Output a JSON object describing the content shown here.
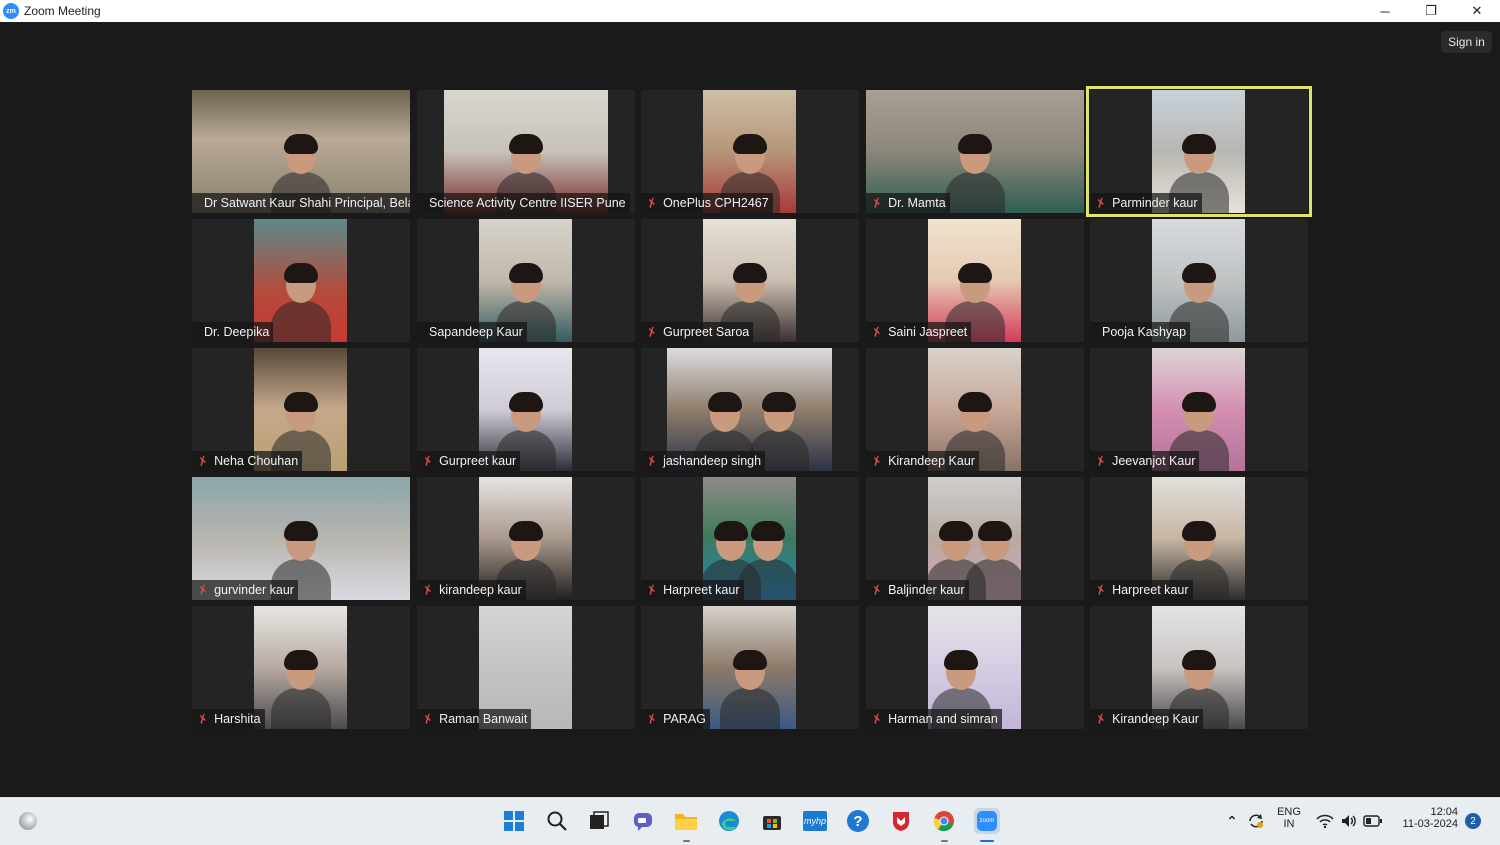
{
  "window": {
    "title": "Zoom Meeting",
    "minimize": "─",
    "restore": "❐",
    "close": "✕"
  },
  "signin": {
    "label": "Sign in"
  },
  "participants": [
    {
      "name": "Dr Satwant Kaur Shahi Principal, Bela ...",
      "muted": false,
      "active": false
    },
    {
      "name": "Science Activity Centre IISER Pune",
      "muted": false,
      "active": false
    },
    {
      "name": "OnePlus CPH2467",
      "muted": true,
      "active": false
    },
    {
      "name": "Dr. Mamta",
      "muted": true,
      "active": false
    },
    {
      "name": "Parminder kaur",
      "muted": true,
      "active": true
    },
    {
      "name": "Dr. Deepika",
      "muted": false,
      "active": false
    },
    {
      "name": "Sapandeep Kaur",
      "muted": false,
      "active": false
    },
    {
      "name": "Gurpreet Saroa",
      "muted": true,
      "active": false
    },
    {
      "name": "Saini Jaspreet",
      "muted": true,
      "active": false
    },
    {
      "name": "Pooja Kashyap",
      "muted": false,
      "active": false
    },
    {
      "name": "Neha Chouhan",
      "muted": true,
      "active": false
    },
    {
      "name": "Gurpreet kaur",
      "muted": true,
      "active": false
    },
    {
      "name": "jashandeep singh",
      "muted": true,
      "active": false
    },
    {
      "name": "Kirandeep Kaur",
      "muted": true,
      "active": false
    },
    {
      "name": "Jeevanjot Kaur",
      "muted": true,
      "active": false
    },
    {
      "name": "gurvinder kaur",
      "muted": true,
      "active": false
    },
    {
      "name": "kirandeep kaur",
      "muted": true,
      "active": false
    },
    {
      "name": "Harpreet kaur",
      "muted": true,
      "active": false
    },
    {
      "name": "Baljinder  kaur",
      "muted": true,
      "active": false
    },
    {
      "name": "Harpreet kaur",
      "muted": true,
      "active": false
    },
    {
      "name": "Harshita",
      "muted": true,
      "active": false
    },
    {
      "name": "Raman Banwait",
      "muted": true,
      "active": false
    },
    {
      "name": "PARAG",
      "muted": true,
      "active": false
    },
    {
      "name": "Harman and simran",
      "muted": true,
      "active": false
    },
    {
      "name": "Kirandeep Kaur",
      "muted": true,
      "active": false
    }
  ],
  "taskbar": {
    "icons": [
      "windows-start-icon",
      "search-icon",
      "task-view-icon",
      "teams-chat-icon",
      "file-explorer-icon",
      "edge-browser-icon",
      "store-icon",
      "myhp-icon",
      "help-icon",
      "mcafee-icon",
      "chrome-icon",
      "zoom-icon"
    ],
    "tray": {
      "lang_top": "ENG",
      "lang_bottom": "IN",
      "time": "12:04",
      "date": "11-03-2024",
      "notifications": "2"
    }
  }
}
